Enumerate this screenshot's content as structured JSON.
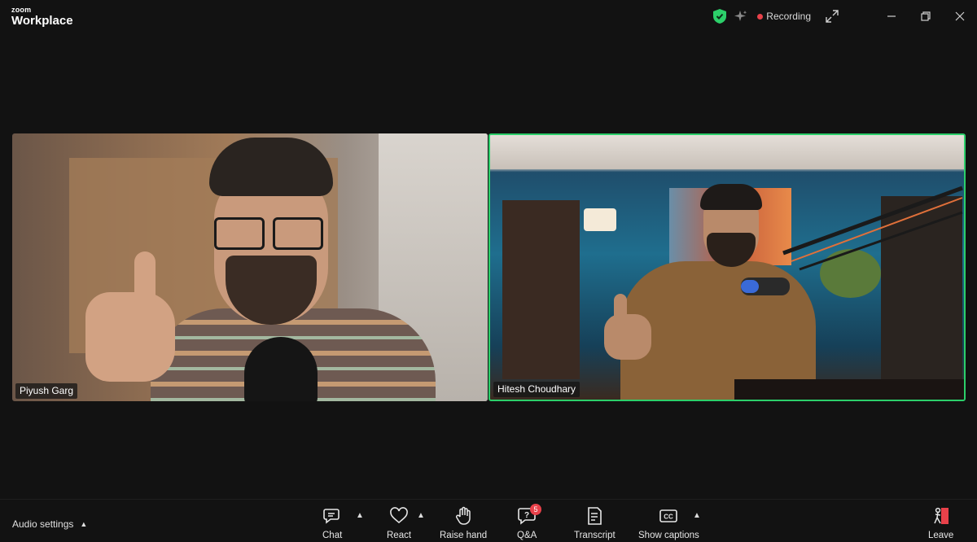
{
  "app": {
    "brand_small": "zoom",
    "brand_big": "Workplace"
  },
  "status": {
    "recording_label": "Recording",
    "recording_color": "#e8414a",
    "secure_color": "#2ccf6a"
  },
  "participants": [
    {
      "name": "Piyush Garg",
      "active_speaker": false
    },
    {
      "name": "Hitesh Choudhary",
      "active_speaker": true
    }
  ],
  "toolbar": {
    "audio_settings": "Audio settings",
    "chat": "Chat",
    "react": "React",
    "raise_hand": "Raise hand",
    "qa": "Q&A",
    "qa_badge": "5",
    "transcript": "Transcript",
    "show_captions": "Show captions",
    "leave": "Leave"
  },
  "icons": [
    "shield-check-icon",
    "sparkle-icon",
    "expand-icon",
    "minimize-icon",
    "restore-icon",
    "close-icon",
    "chat-icon",
    "heart-icon",
    "hand-icon",
    "qa-icon",
    "transcript-icon",
    "cc-icon",
    "leave-icon"
  ]
}
